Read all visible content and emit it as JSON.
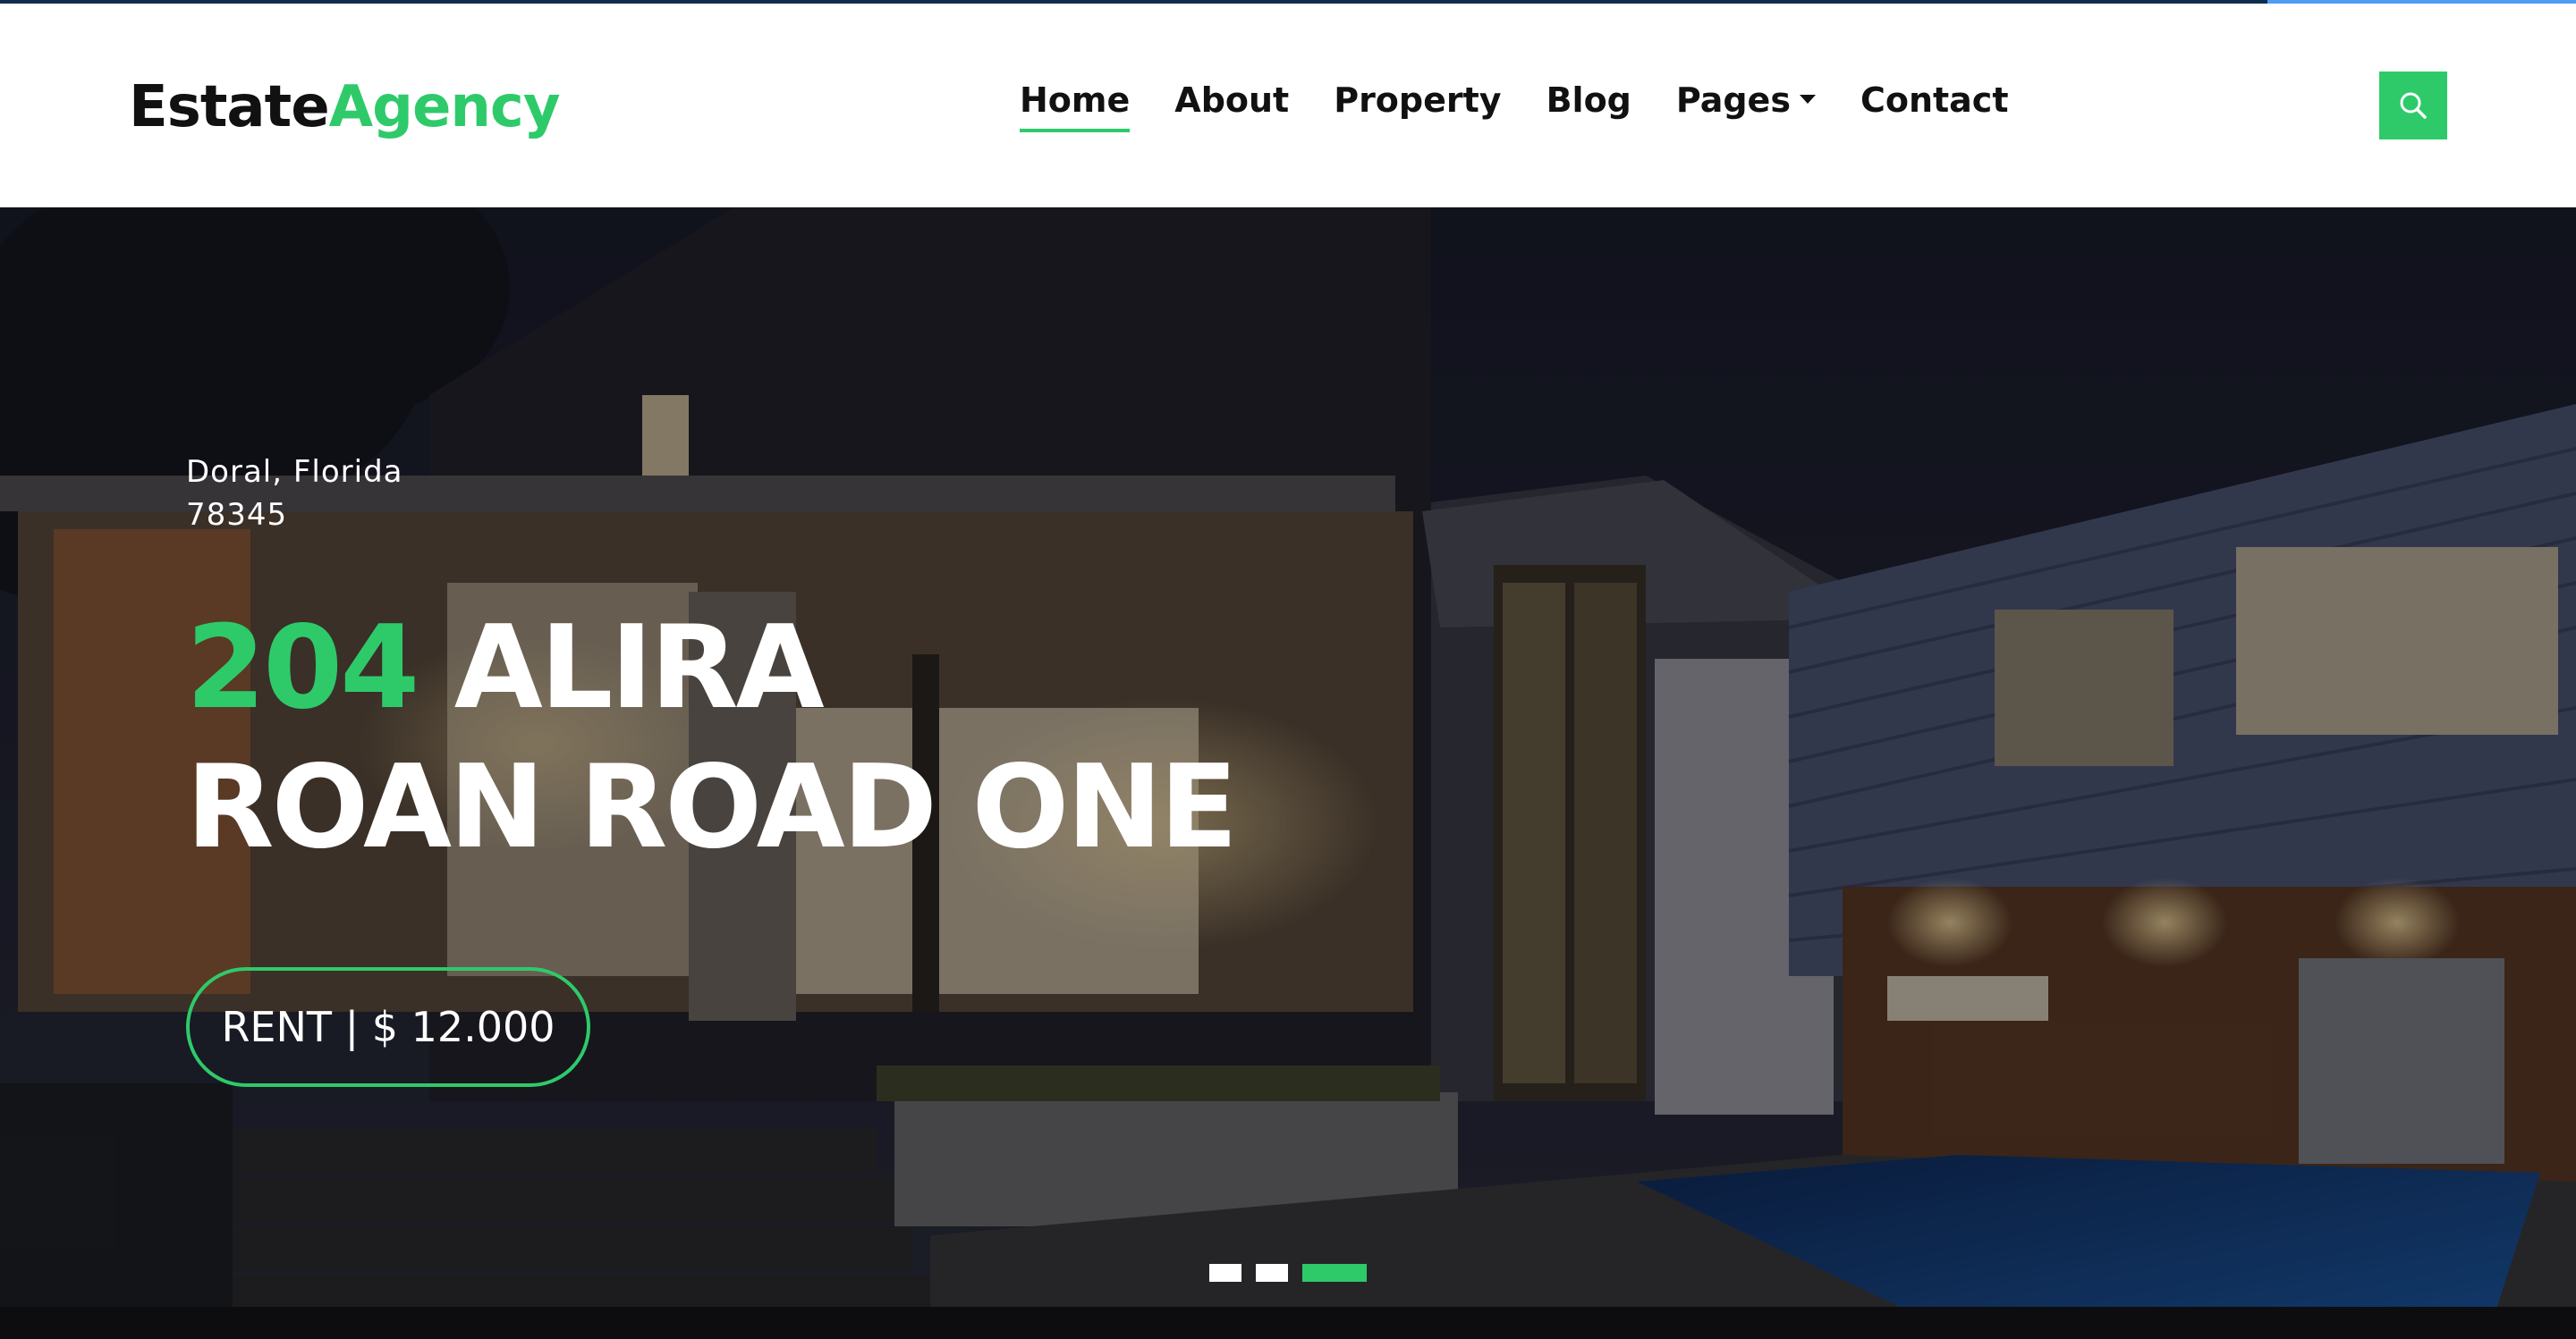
{
  "brand": {
    "part1": "Estate",
    "part2": "Agency"
  },
  "nav": {
    "items": [
      {
        "label": "Home",
        "active": true
      },
      {
        "label": "About"
      },
      {
        "label": "Property"
      },
      {
        "label": "Blog"
      },
      {
        "label": "Pages",
        "dropdown": true
      },
      {
        "label": "Contact"
      }
    ]
  },
  "search": {
    "icon": "search-icon"
  },
  "hero": {
    "location_line1": "Doral, Florida",
    "location_line2": "78345",
    "title_number": "204",
    "title_rest": "ALIRA",
    "title_line2": "ROAN ROAD ONE",
    "price_label": "RENT | $ 12.000",
    "slides_total": 3,
    "active_slide": 3
  },
  "colors": {
    "accent": "#2eca6a",
    "text_dark": "#111111",
    "topbar": "#0f2c4d",
    "topbar_accent": "#4d9bf2"
  }
}
